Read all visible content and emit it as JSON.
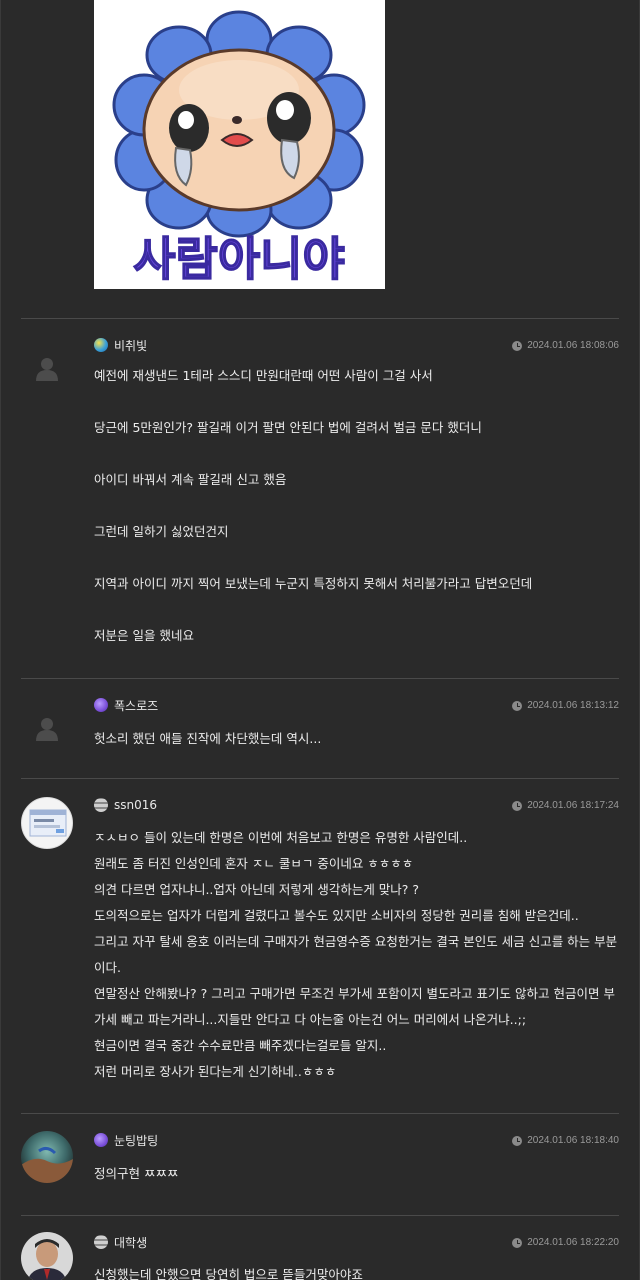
{
  "sticker": {
    "caption": "사람아니야",
    "icon": "crying-sunflower-sticker"
  },
  "comments": [
    {
      "nick": "비취빛",
      "date": "2024.01.06 18:08:06",
      "level_color": "#3aa0d8",
      "lines": [
        "예전에 재생낸드 1테라 스스디 만원대란때  어떤 사람이 그걸 사서",
        "당근에 5만원인가?  팔길래 이거 팔면 안된다 법에 걸려서 벌금 문다 했더니",
        "아이디 바꿔서 계속 팔길래 신고 했음",
        "그런데 일하기 싫었던건지",
        "지역과 아이디 까지 찍어 보냈는데 누군지 특정하지 못해서 처리불가라고 답변오던데",
        "저분은 일을 했네요"
      ]
    },
    {
      "nick": "폭스로즈",
      "date": "2024.01.06 18:13:12",
      "level_color": "#7a4fd8",
      "lines": [
        "헛소리 했던 애들 진작에 차단했는데 역시..."
      ]
    },
    {
      "nick": "ssn016",
      "date": "2024.01.06 18:17:24",
      "level_color": "#9a9a9a",
      "lines": [
        "ㅈㅅㅂㅇ 들이 있는데 한명은 이번에 처음보고 한명은 유명한 사람인데..",
        "원래도 좀 터진 인성인데 혼자 ㅈㄴ 쿨ㅂㄱ 중이네요 ㅎㅎㅎㅎ",
        "의견 다르면 업자냐니..업자 아닌데 저렇게 생각하는게 맞나? ?",
        "도의적으로는 업자가 더럽게 걸렸다고 볼수도 있지만 소비자의 정당한 권리를 침해 받은건데..",
        "그리고 자꾸 탈세 옹호 이러는데 구매자가 현금영수증 요청한거는 결국 본인도 세금 신고를 하는 부분이다.",
        "연말정산 안해봤나? ? 그리고 구매가면 무조건 부가세 포함이지 별도라고 표기도 않하고 현금이면 부가세 빼고 파는거라니...지들만 안다고 다 아는줄 아는건 어느 머리에서 나온거냐..;;",
        "현금이면 결국 중간 수수료만큼 빼주겠다는걸로들 알지..",
        "저런 머리로 장사가 된다는게 신기하네..ㅎㅎㅎ"
      ]
    },
    {
      "nick": "눈팅밥팅",
      "date": "2024.01.06 18:18:40",
      "level_color": "#7a4fd8",
      "lines": [
        "정의구현 ㅉㅉㅉ"
      ]
    },
    {
      "nick": "대학생",
      "date": "2024.01.06 18:22:20",
      "level_color": "#9a9a9a",
      "lines": [
        "신청했는데 안했으면 당연히 법으로 뜯들거맞아야죠"
      ]
    }
  ]
}
